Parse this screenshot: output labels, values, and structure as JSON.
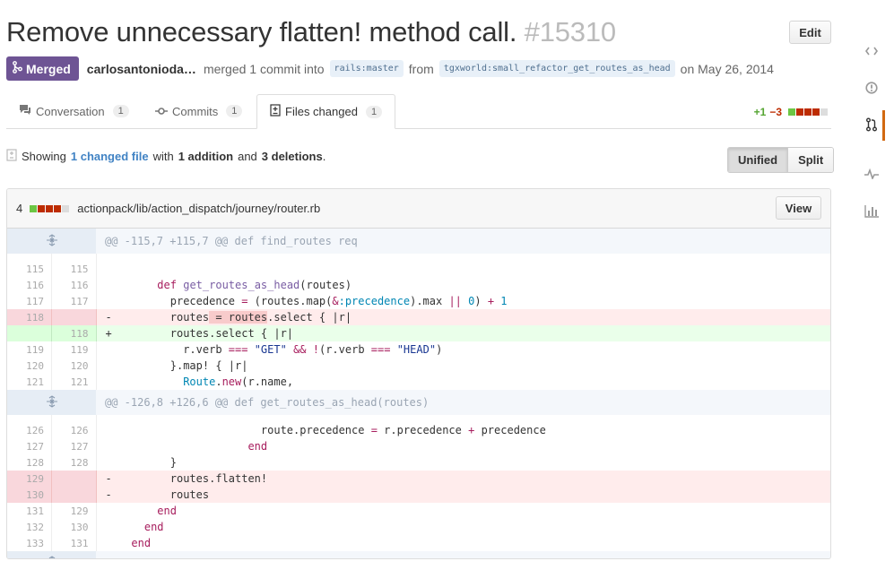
{
  "pr": {
    "title": "Remove unnecessary flatten! method call.",
    "number": "#15310",
    "edit_label": "Edit",
    "state": "Merged",
    "author": "carlosantonioda…",
    "merged_text": "merged 1 commit into",
    "base_branch": "rails:master",
    "from_text": "from",
    "head_branch": "tgxworld:small_refactor_get_routes_as_head",
    "date_text": "on May 26, 2014"
  },
  "tabs": [
    {
      "label": "Conversation",
      "count": "1"
    },
    {
      "label": "Commits",
      "count": "1"
    },
    {
      "label": "Files changed",
      "count": "1"
    }
  ],
  "diffstat": {
    "additions": "+1",
    "deletions": "−3"
  },
  "summary": {
    "prefix": "Showing",
    "files_link": "1 changed file",
    "with": "with",
    "additions": "1 addition",
    "and": "and",
    "deletions": "3 deletions",
    "suffix": "."
  },
  "view_toggle": {
    "unified": "Unified",
    "split": "Split"
  },
  "file": {
    "changes": "4",
    "path": "actionpack/lib/action_dispatch/journey/router.rb",
    "view_label": "View"
  },
  "hunks": [
    "@@ -115,7 +115,7 @@ def find_routes req",
    "@@ -126,8 +126,6 @@ def get_routes_as_head(routes)"
  ],
  "lines": [
    {
      "old": "115",
      "new": "115",
      "type": "ctx",
      "text": ""
    },
    {
      "old": "116",
      "new": "116",
      "type": "ctx",
      "text": "        def get_routes_as_head(routes)"
    },
    {
      "old": "117",
      "new": "117",
      "type": "ctx",
      "text": "          precedence = (routes.map(&:precedence).max || 0) + 1"
    },
    {
      "old": "118",
      "new": "",
      "type": "del",
      "text": "-         routes = routes.select { |r|"
    },
    {
      "old": "",
      "new": "118",
      "type": "ins",
      "text": "+         routes.select { |r|"
    },
    {
      "old": "119",
      "new": "119",
      "type": "ctx",
      "text": "            r.verb === \"GET\" && !(r.verb === \"HEAD\")"
    },
    {
      "old": "120",
      "new": "120",
      "type": "ctx",
      "text": "          }.map! { |r|"
    },
    {
      "old": "121",
      "new": "121",
      "type": "ctx",
      "text": "            Route.new(r.name,"
    },
    {
      "old": "126",
      "new": "126",
      "type": "ctx",
      "text": "                        route.precedence = r.precedence + precedence"
    },
    {
      "old": "127",
      "new": "127",
      "type": "ctx",
      "text": "                      end"
    },
    {
      "old": "128",
      "new": "128",
      "type": "ctx",
      "text": "          }"
    },
    {
      "old": "129",
      "new": "",
      "type": "del",
      "text": "-         routes.flatten!"
    },
    {
      "old": "130",
      "new": "",
      "type": "del",
      "text": "-         routes"
    },
    {
      "old": "131",
      "new": "129",
      "type": "ctx",
      "text": "        end"
    },
    {
      "old": "132",
      "new": "130",
      "type": "ctx",
      "text": "      end"
    },
    {
      "old": "133",
      "new": "131",
      "type": "ctx",
      "text": "    end"
    }
  ],
  "sidebar_icons": [
    "code-icon",
    "issue-icon",
    "pull-request-icon",
    "pulse-icon",
    "graph-icon"
  ],
  "colors": {
    "merged": "#6e5494",
    "addition": "#55a532",
    "deletion": "#bd2c00",
    "link": "#4183c4",
    "active_indicator": "#d26911"
  }
}
